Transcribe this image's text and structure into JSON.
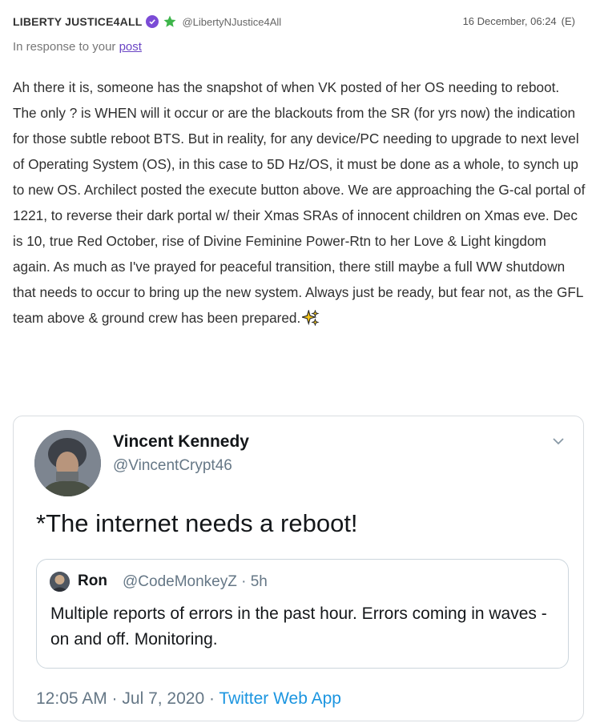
{
  "post": {
    "author": "LIBERTY JUSTICE4ALL",
    "handle": "@LibertyNJustice4All",
    "timestamp": "16 December, 06:24",
    "edited_mark": "(E)",
    "response_prefix": "In response to your",
    "response_link": "post",
    "body": "Ah there it is, someone has the snapshot of when VK posted of her OS needing to reboot. The only ? is WHEN will it occur or are the blackouts from the SR (for yrs now) the indication for those subtle reboot BTS. But in reality, for any device/PC needing to upgrade to next level of Operating System (OS), in this case to 5D Hz/OS, it must be done as a whole, to synch up to new OS. Archilect posted the execute button above. We are approaching the G-cal portal of 1221, to reverse their dark portal w/ their Xmas SRAs of innocent children on Xmas eve. Dec is 10, true Red October, rise of Divine Feminine Power-Rtn to her Love & Light kingdom again. As much as I've prayed for peaceful transition, there still maybe a full WW shutdown that needs to occur to bring up the new system. Always just be ready, but fear not, as the GFL team above & ground crew has been prepared."
  },
  "tweet": {
    "name": "Vincent Kennedy",
    "handle": "@VincentCrypt46",
    "text": "*The internet needs a reboot!",
    "quote": {
      "name": "Ron",
      "handle_time": "@CodeMonkeyZ · 5h",
      "text": "Multiple reports of errors in the past hour. Errors coming in waves - on and off. Monitoring."
    },
    "time": "12:05 AM · Jul 7, 2020 · ",
    "app": "Twitter Web App"
  },
  "icons": {
    "verified": "verified-badge-icon",
    "star": "star-icon",
    "sparkle": "sparkle-emoji-icon",
    "chevron": "chevron-down-icon"
  },
  "colors": {
    "verified_badge": "#7b4bd6",
    "star": "#3db54a",
    "link": "#6a45c4",
    "twitter_blue": "#1b95e0"
  }
}
